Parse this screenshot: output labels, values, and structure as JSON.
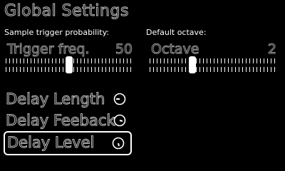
{
  "title": "Global Settings",
  "sliders": [
    {
      "section_label": "Sample trigger probability:",
      "name": "Trigger freq.",
      "value": "50",
      "position_fraction": 0.5
    },
    {
      "section_label": "Default octave:",
      "name": "Octave",
      "value": "2",
      "position_fraction": 0.33
    }
  ],
  "menu": [
    {
      "label": "Delay Length",
      "icon": "knob-left-icon",
      "selected": false
    },
    {
      "label": "Delay Feeback",
      "icon": "knob-down-right-icon",
      "selected": false
    },
    {
      "label": "Delay Level",
      "icon": "knob-down-icon",
      "selected": true
    }
  ],
  "colors": {
    "background": "#000000",
    "foreground": "#ffffff",
    "outline_text": "#bdbdbd"
  }
}
